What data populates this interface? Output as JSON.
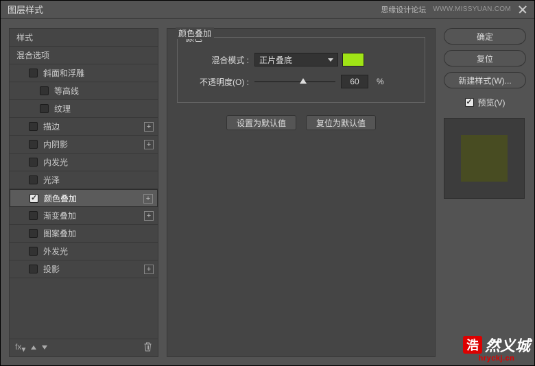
{
  "titlebar": {
    "title": "图层样式",
    "forum": "思缘设计论坛",
    "forum_url": "WWW.MISSYUAN.COM"
  },
  "left": {
    "header_styles": "样式",
    "header_blend": "混合选项",
    "items": {
      "bevel": "斜面和浮雕",
      "contour": "等高线",
      "texture": "纹理",
      "stroke": "描边",
      "inner_shadow": "内阴影",
      "inner_glow": "内发光",
      "satin": "光泽",
      "color_overlay": "颜色叠加",
      "gradient_overlay": "渐变叠加",
      "pattern_overlay": "图案叠加",
      "outer_glow": "外发光",
      "drop_shadow": "投影"
    },
    "footer_fx": "fx"
  },
  "mid": {
    "group_outer": "颜色叠加",
    "group_inner": "颜色",
    "blend_label": "混合模式 :",
    "blend_value": "正片叠底",
    "color_swatch": "#A0E416",
    "opacity_label": "不透明度(O) :",
    "opacity_value": "60",
    "opacity_unit": "%",
    "opacity_percent": 60,
    "set_default": "设置为默认值",
    "reset_default": "复位为默认值"
  },
  "right": {
    "ok": "确定",
    "reset": "复位",
    "new_style": "新建样式(W)...",
    "preview": "预览(V)",
    "preview_color": "#484C22"
  },
  "watermark": {
    "hao": "浩",
    "rest": "然义城",
    "url": "hryckj.cn"
  }
}
